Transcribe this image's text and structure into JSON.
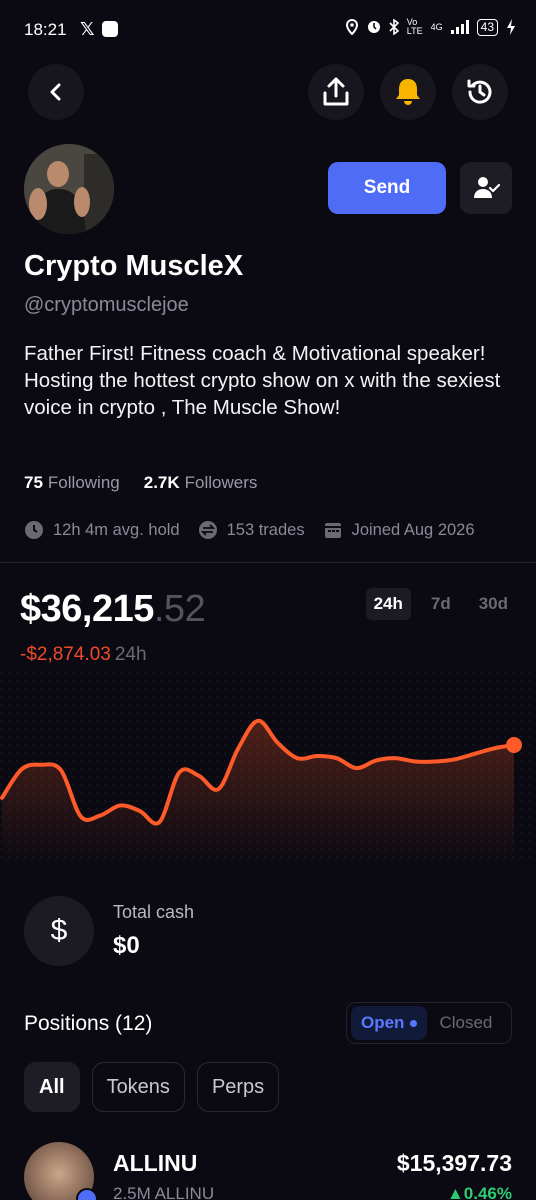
{
  "status_bar": {
    "time": "18:21",
    "battery": "43",
    "network": "4G"
  },
  "profile": {
    "name": "Crypto MuscleX",
    "handle": "@cryptomusclejoe",
    "bio": "Father First!  Fitness coach & Motivational speaker! Hosting the hottest crypto show on x with the sexiest voice in crypto , The Muscle Show!",
    "following_count": "75",
    "following_label": "Following",
    "followers_count": "2.7K",
    "followers_label": "Followers",
    "avg_hold": "12h 4m avg. hold",
    "trades": "153 trades",
    "joined": "Joined Aug 2026"
  },
  "actions": {
    "send_label": "Send"
  },
  "portfolio": {
    "balance_main": "$36,215",
    "balance_cents": ".52",
    "change": "-$2,874.03",
    "change_period": "24h",
    "ranges": [
      "24h",
      "7d",
      "30d"
    ],
    "active_range": "24h"
  },
  "chart_data": {
    "type": "line",
    "x": [
      0,
      1,
      2,
      3,
      4,
      5,
      6,
      7,
      8,
      9,
      10,
      11,
      12,
      13,
      14,
      15,
      16,
      17,
      18,
      19,
      20,
      21,
      22,
      23,
      24,
      25,
      26
    ],
    "values": [
      0.22,
      0.48,
      0.52,
      0.47,
      0.05,
      0.06,
      0.15,
      0.1,
      0.0,
      0.45,
      0.42,
      0.3,
      0.67,
      0.92,
      0.72,
      0.58,
      0.6,
      0.58,
      0.49,
      0.56,
      0.58,
      0.55,
      0.55,
      0.57,
      0.62,
      0.67,
      0.7
    ],
    "ylim": [
      0,
      1
    ],
    "title": "",
    "xlabel": "",
    "ylabel": "",
    "color": "#ff5a2a"
  },
  "cash": {
    "label": "Total cash",
    "value": "$0",
    "icon": "dollar-icon"
  },
  "positions": {
    "title": "Positions (12)",
    "open_label": "Open",
    "closed_label": "Closed",
    "filters": [
      "All",
      "Tokens",
      "Perps"
    ],
    "items": [
      {
        "name": "ALLINU",
        "amount": "2.5M ALLINU",
        "value": "$15,397.73",
        "change": "▲0.46%"
      }
    ]
  },
  "colors": {
    "accent": "#4f6cf7",
    "negative": "#f04a2a",
    "positive": "#2ecc71",
    "bell": "#f7b500"
  }
}
